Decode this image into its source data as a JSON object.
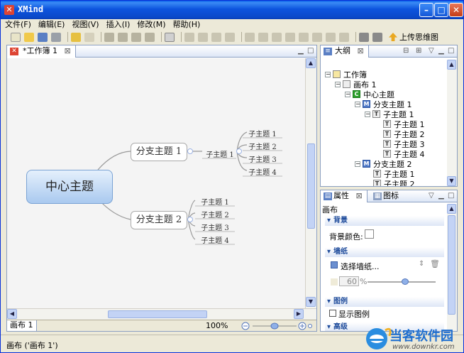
{
  "window": {
    "title": "XMind",
    "app_icon": "xmind-logo-icon"
  },
  "menu": [
    "文件(F)",
    "编辑(E)",
    "视图(V)",
    "插入(I)",
    "修改(M)",
    "帮助(H)"
  ],
  "toolbar": {
    "upload_label": "上传思维图"
  },
  "editor": {
    "tab_label": "*工作簿 1",
    "sheet_tab": "画布 1",
    "zoom": "100%"
  },
  "map": {
    "central": "中心主题",
    "branches": [
      {
        "label": "分支主题 1",
        "child": "子主题 1",
        "grandchildren": [
          "子主题 1",
          "子主题 2",
          "子主题 3",
          "子主题 4"
        ]
      },
      {
        "label": "分支主题 2",
        "children": [
          "子主题 1",
          "子主题 2",
          "子主题 3",
          "子主题 4"
        ]
      }
    ]
  },
  "outline": {
    "tab_label": "大纲",
    "rows": [
      {
        "label": "工作簿",
        "icon": "W"
      },
      {
        "label": "画布 1",
        "icon": "S"
      },
      {
        "label": "中心主题",
        "icon": "C"
      },
      {
        "label": "分支主题 1",
        "icon": "M"
      },
      {
        "label": "子主题 1",
        "icon": "T"
      },
      {
        "label": "子主题 1",
        "icon": "T"
      },
      {
        "label": "子主题 2",
        "icon": "T"
      },
      {
        "label": "子主题 3",
        "icon": "T"
      },
      {
        "label": "子主题 4",
        "icon": "T"
      },
      {
        "label": "分支主题 2",
        "icon": "M"
      },
      {
        "label": "子主题 1",
        "icon": "T"
      },
      {
        "label": "子主题 2",
        "icon": "T"
      }
    ]
  },
  "properties": {
    "tab_label": "属性",
    "tab2_label": "图标",
    "context": "画布",
    "background_section": "背景",
    "background_color_label": "背景颜色:",
    "wallpaper_section": "墙纸",
    "wallpaper_select": "选择墙纸...",
    "opacity_value": "60",
    "opacity_unit": "%",
    "legend_section": "图例",
    "show_legend": "显示图例",
    "advanced_section": "高级"
  },
  "status": {
    "text": "画布 ('画布 1')"
  },
  "watermark": {
    "brand": "当客软件园",
    "url": "www.downkr.com"
  }
}
